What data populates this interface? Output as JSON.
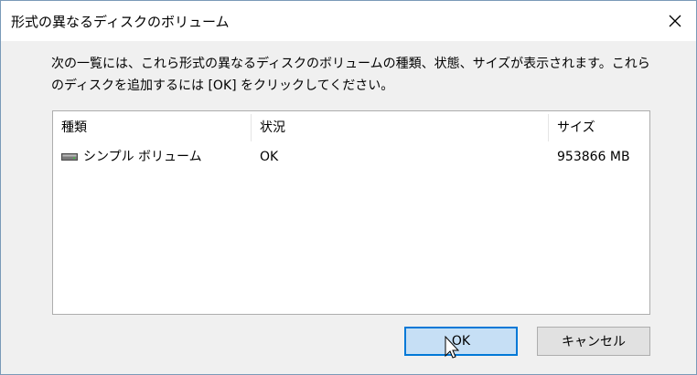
{
  "dialog": {
    "title": "形式の異なるディスクのボリューム",
    "close_glyph": "✕",
    "description": "次の一覧には、これら形式の異なるディスクのボリュームの種類、状態、サイズが表示されます。これらのディスクを追加するには [OK] をクリックしてください。"
  },
  "list": {
    "columns": [
      "種類",
      "状況",
      "サイズ"
    ],
    "rows": [
      {
        "icon": "disk-icon",
        "type": "シンプル ボリューム",
        "status": "OK",
        "size": "953866 MB"
      }
    ]
  },
  "buttons": {
    "ok_label": "OK",
    "cancel_label": "キャンセル"
  },
  "colors": {
    "accent": "#0078d7",
    "ok_button_fill": "#c6dff5",
    "dialog_background": "#f0f0f0"
  }
}
